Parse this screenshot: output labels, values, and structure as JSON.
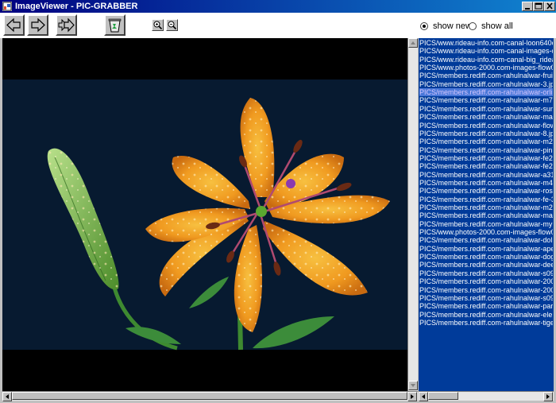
{
  "window": {
    "title": "ImageViewer - PIC-GRABBER"
  },
  "toolbar": {
    "back_icon": "arrow-left-icon",
    "forward_icon": "arrow-right-icon",
    "fast_forward_icon": "double-arrow-right-icon",
    "delete_icon": "recycle-bin-icon",
    "zoom_in_icon": "zoom-in-icon",
    "zoom_out_icon": "zoom-out-icon"
  },
  "view_mode": {
    "options": [
      {
        "label": "show new",
        "checked": true
      },
      {
        "label": "show all",
        "checked": false
      }
    ]
  },
  "image": {
    "subject_icon": "orange-lily-image"
  },
  "file_list": {
    "selected_index": 7,
    "items": [
      "PICS/www.rideau-info.com-canal-loon640c.jpg",
      "PICS/www.rideau-info.com-canal-images-da",
      "PICS/www.rideau-info.com-canal-big_rideau",
      "PICS/www.photos-2000.com-images-flow01",
      "PICS/members.rediff.com-rahulnalwar-fruitb",
      "PICS/members.rediff.com-rahulnalwar-3.jpg",
      "PICS/members.rediff.com-rahulnalwar-orlily.j",
      "PICS/members.rediff.com-rahulnalwar-m73.j",
      "PICS/members.rediff.com-rahulnalwar-summ",
      "PICS/members.rediff.com-rahulnalwar-mar1",
      "PICS/members.rediff.com-rahulnalwar-flowe",
      "PICS/members.rediff.com-rahulnalwar-8.jpg",
      "PICS/members.rediff.com-rahulnalwar-m21.j",
      "PICS/members.rediff.com-rahulnalwar-pink_",
      "PICS/members.rediff.com-rahulnalwar-fe20-",
      "PICS/members.rediff.com-rahulnalwar-fe20-",
      "PICS/members.rediff.com-rahulnalwar-a31.jp",
      "PICS/members.rediff.com-rahulnalwar-m41.j",
      "PICS/members.rediff.com-rahulnalwar-roses",
      "PICS/members.rediff.com-rahulnalwar-fe-33.",
      "PICS/members.rediff.com-rahulnalwar-m22.j",
      "PICS/members.rediff.com-rahulnalwar-mar2",
      "PICS/members.rediff.com-rahulnalwar-myph",
      "PICS/www.photos-2000.com-images-flow01",
      "PICS/members.rediff.com-rahulnalwar-dolph",
      "PICS/members.rediff.com-rahulnalwar-ape01",
      "PICS/members.rediff.com-rahulnalwar-dog0",
      "PICS/members.rediff.com-rahulnalwar-deer0",
      "PICS/members.rediff.com-rahulnalwar-s095",
      "PICS/members.rediff.com-rahulnalwar-2000",
      "PICS/members.rediff.com-rahulnalwar-2000",
      "PICS/members.rediff.com-rahulnalwar-s095",
      "PICS/members.rediff.com-rahulnalwar-parro",
      "PICS/members.rediff.com-rahulnalwar-eleph",
      "PICS/members.rediff.com-rahulnalwar-tiger6"
    ]
  },
  "colors": {
    "list_background": "#003b9a",
    "list_text": "#ffffff",
    "selection": "#4a78d8",
    "titlebar": "#000080"
  }
}
